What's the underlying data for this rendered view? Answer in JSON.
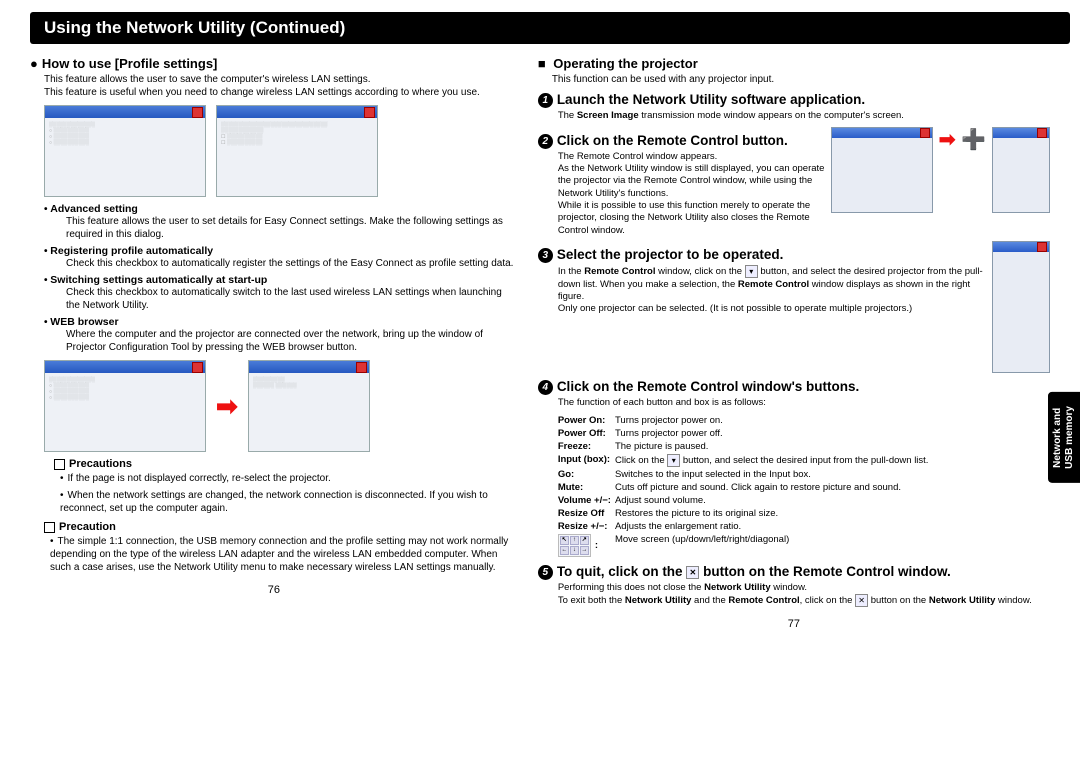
{
  "header": "Using the Network Utility (Continued)",
  "left": {
    "section_title": "How to use [Profile settings]",
    "section_intro": "This feature allows the user to save the computer's wireless LAN settings.\nThis feature is useful when you need to change wireless LAN settings according to where you use.",
    "items": [
      {
        "title": "Advanced setting",
        "body": "This feature allows the user to set details for Easy Connect settings. Make the following settings as required in this dialog."
      },
      {
        "title": "Registering profile automatically",
        "body": "Check this checkbox to automatically register the settings of the Easy Connect as profile setting data."
      },
      {
        "title": "Switching settings automatically at start-up",
        "body": "Check this checkbox to automatically switch to the last used wireless LAN settings when launching the Network Utility."
      },
      {
        "title": "WEB browser",
        "body": "Where the computer and the projector are connected over the network, bring up the window of Projector Configuration Tool by pressing the WEB browser button."
      }
    ],
    "precautions_heading": "Precautions",
    "precautions": [
      "If the page is not displayed correctly, re-select the projector.",
      "When the network settings are changed, the network connection is disconnected. If you wish to reconnect, set up the computer again."
    ],
    "precaution_heading": "Precaution",
    "precaution_body": "The simple 1:1 connection, the USB memory connection and the profile setting may not work normally depending on the type of the wireless LAN adapter and the wireless LAN embedded computer. When such a case arises, use the Network Utility menu to make necessary wireless LAN settings manually.",
    "page": "76"
  },
  "right": {
    "section_title": "Operating the projector",
    "section_intro": "This function can be used with any projector input.",
    "step1_title": "Launch the Network Utility software application.",
    "step1_body_prefix": "The ",
    "step1_body_bold": "Screen Image",
    "step1_body_suffix": " transmission mode window appears on the computer's screen.",
    "step2_title": "Click on the Remote Control button.",
    "step2_body": "The Remote Control window appears.\nAs the Network Utility window is still displayed, you can operate the projector via the Remote Control window, while using the Network Utility's functions.\nWhile it is possible to use this function merely to operate the projector, closing the Network Utility also closes the Remote Control window.",
    "step3_title": "Select the projector to be operated.",
    "step3_body": "In the Remote Control window, click on the ▾ button, and select the desired projector from the pull-down list. When you make a selection, the Remote Control window displays as shown in the right figure.\nOnly one projector can be selected. (It is not possible to operate multiple projectors.)",
    "step4_title": "Click on the Remote Control window's buttons.",
    "step4_intro": "The function of each button and box is as follows:",
    "buttons": [
      {
        "k": "Power On:",
        "v": "Turns projector power on."
      },
      {
        "k": "Power Off:",
        "v": "Turns projector power off."
      },
      {
        "k": "Freeze:",
        "v": "The picture is paused."
      },
      {
        "k": "Input (box):",
        "v": "Click on the ▾ button, and select the desired input from the pull-down list."
      },
      {
        "k": "Go:",
        "v": "Switches to the input selected in the Input box."
      },
      {
        "k": "Mute:",
        "v": "Cuts off picture and sound. Click again to restore picture and sound."
      },
      {
        "k": "Volume +/−:",
        "v": "Adjust sound volume."
      },
      {
        "k": "Resize Off",
        "v": "Restores the picture to its original size."
      },
      {
        "k": "Resize +/−:",
        "v": "Adjusts the enlargement ratio."
      }
    ],
    "dpad_desc": "Move screen (up/down/left/right/diagonal)",
    "step5_title_a": "To quit, click on the ",
    "step5_title_b": " button on the Remote Control window.",
    "step5_body": "Performing this does not close the Network Utility window.\nTo exit both the Network Utility and the Remote Control, click on the ✕ button on the Network Utility window.",
    "page": "77",
    "side_tab": "Network and\nUSB memory"
  }
}
